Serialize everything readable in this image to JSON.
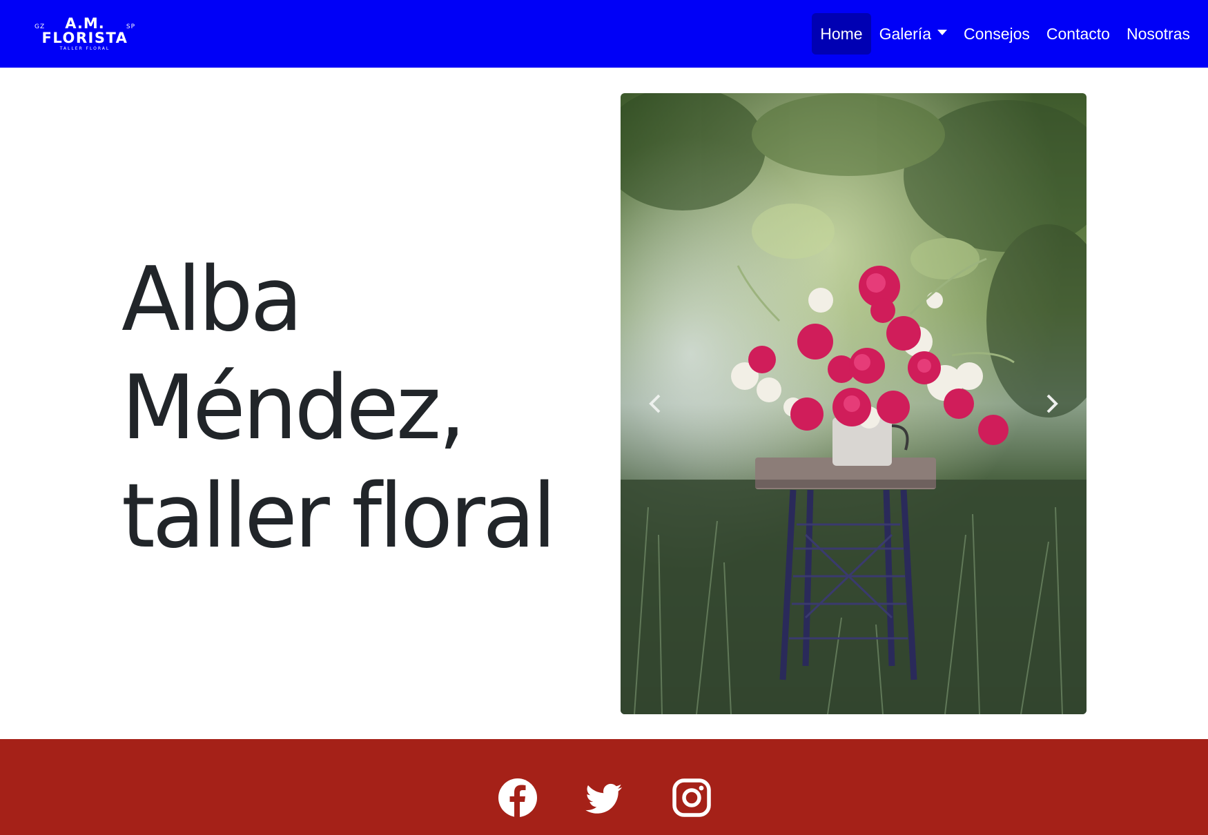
{
  "brand": {
    "logo_top_left": "GZ",
    "logo_top_center": "A.M.",
    "logo_top_right": "SP",
    "logo_main": "FLORISTA",
    "logo_sub": "TALLER FLORAL"
  },
  "nav": {
    "items": [
      {
        "label": "Home",
        "active": true
      },
      {
        "label": "Galería",
        "dropdown": true
      },
      {
        "label": "Consejos"
      },
      {
        "label": "Contacto"
      },
      {
        "label": "Nosotras"
      }
    ]
  },
  "hero": {
    "line1": "Alba",
    "line2": "Méndez,",
    "line3": "taller floral"
  },
  "carousel": {
    "prev_icon": "chevron-left-icon",
    "next_icon": "chevron-right-icon"
  },
  "footer": {
    "social": [
      "facebook-icon",
      "twitter-icon",
      "instagram-icon"
    ]
  },
  "colors": {
    "navbar": "#0000f7",
    "nav_active": "#0000b3",
    "footer": "#a52118",
    "text": "#212529"
  }
}
